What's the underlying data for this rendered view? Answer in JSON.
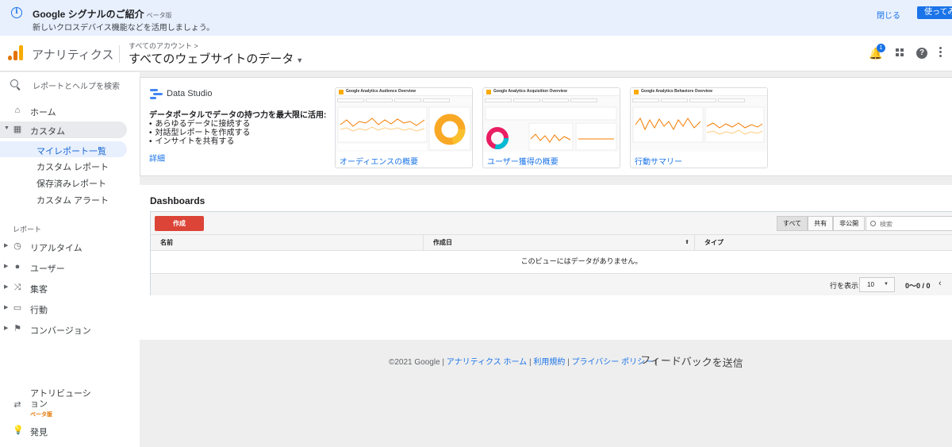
{
  "banner": {
    "title": "Google シグナルのご紹介",
    "beta": "ベータ版",
    "subtitle": "新しいクロスデバイス機能などを活用しましょう。",
    "close_label": "閉じる",
    "use_label": "使ってみる"
  },
  "header": {
    "app_name": "アナリティクス",
    "breadcrumb": "すべてのアカウント >",
    "property": "すべてのウェブサイトのデータ",
    "notification_count": "1"
  },
  "sidebar": {
    "search_placeholder": "レポートとヘルプを検索",
    "home": "ホーム",
    "custom": "カスタム",
    "sub_items": [
      "マイレポート一覧",
      "カスタム レポート",
      "保存済みレポート",
      "カスタム アラート"
    ],
    "reports_section": "レポート",
    "reports": [
      "リアルタイム",
      "ユーザー",
      "集客",
      "行動",
      "コンバージョン"
    ],
    "attribution": "アトリビューション",
    "attribution_beta": "ベータ版",
    "discover": "発見"
  },
  "data_studio": {
    "name": "Data Studio",
    "headline": "データポータルでデータの持つ力を最大限に活用:",
    "bullets": [
      "あらゆるデータに接続する",
      "対話型レポートを作成する",
      "インサイトを共有する"
    ],
    "details_link": "詳細",
    "templates": [
      {
        "thumb_title": "Google Analytics Audience Overview",
        "caption": "オーディエンスの概要"
      },
      {
        "thumb_title": "Google Analytics Acquisition Overview",
        "caption": "ユーザー獲得の概要"
      },
      {
        "thumb_title": "Google Analytics Behaviors Overview",
        "caption": "行動サマリー"
      }
    ]
  },
  "dashboards": {
    "title": "Dashboards",
    "create_label": "作成",
    "filters": [
      "すべて",
      "共有",
      "非公開"
    ],
    "search_placeholder": "検索",
    "columns": [
      "名前",
      "作成日",
      "タイプ"
    ],
    "empty_message": "このビューにはデータがありません。",
    "rows_label": "行を表示",
    "rows_value": "10",
    "range": "0～0 / 0"
  },
  "footer": {
    "copyright": "©2021 Google |",
    "links": [
      "アナリティクス ホーム",
      "利用規約",
      "プライバシー ポリシー"
    ],
    "feedback": "フィードバックを送信"
  },
  "colors": {
    "accent": "#1a73e8",
    "create": "#db4437",
    "ga_orange": "#e37400",
    "ga_yellow": "#f9ab00"
  }
}
